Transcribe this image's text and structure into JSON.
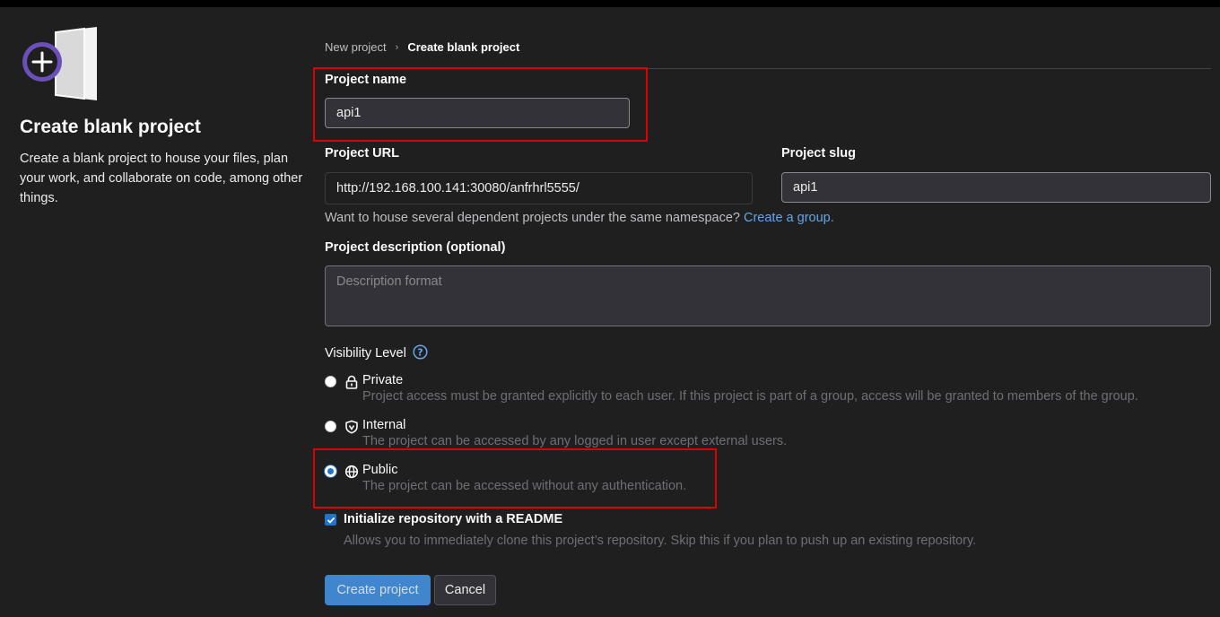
{
  "hero": {
    "title": "Create blank project",
    "description": "Create a blank project to house your files, plan your work, and collaborate on code, among other things."
  },
  "breadcrumb": {
    "parent": "New project",
    "separator": "›",
    "current": "Create blank project"
  },
  "project_name": {
    "label": "Project name",
    "value": "api1"
  },
  "project_url": {
    "label": "Project URL",
    "value": "http://192.168.100.141:30080/anfrhrl5555/"
  },
  "project_slug": {
    "label": "Project slug",
    "value": "api1"
  },
  "namespace_help": {
    "text": "Want to house several dependent projects under the same namespace?",
    "link": "Create a group."
  },
  "description": {
    "label": "Project description (optional)",
    "placeholder": "Description format"
  },
  "visibility": {
    "label": "Visibility Level",
    "options": [
      {
        "label": "Private",
        "icon": "lock-icon",
        "checked": false,
        "description": "Project access must be granted explicitly to each user. If this project is part of a group, access will be granted to members of the group."
      },
      {
        "label": "Internal",
        "icon": "shield-icon",
        "checked": false,
        "description": "The project can be accessed by any logged in user except external users."
      },
      {
        "label": "Public",
        "icon": "globe-icon",
        "checked": true,
        "description": "The project can be accessed without any authentication."
      }
    ]
  },
  "readme": {
    "label": "Initialize repository with a README",
    "checked": true,
    "description": "Allows you to immediately clone this project’s repository. Skip this if you plan to push up an existing repository."
  },
  "buttons": {
    "create": "Create project",
    "cancel": "Cancel"
  },
  "colors": {
    "accent": "#1f75cb",
    "link": "#63a6e9",
    "highlight": "#e00000",
    "background": "#1f1f1f"
  }
}
